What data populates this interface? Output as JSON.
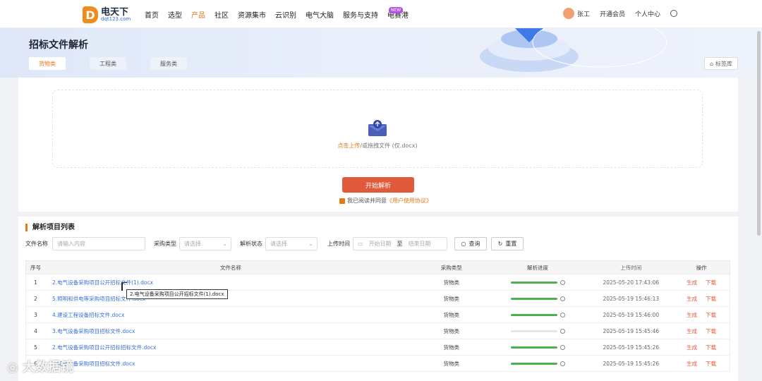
{
  "nav": {
    "logo_mark": "D",
    "logo_cn": "电天下",
    "logo_en": "dqt123.com",
    "items": [
      "首页",
      "选型",
      "产品",
      "社区",
      "资源集市",
      "云识别",
      "电气大脑",
      "服务与支持",
      "电赛港"
    ],
    "active_item": "产品",
    "new_badge": "NEW",
    "user_name": "张工",
    "membership": "开通会员",
    "personal_center": "个人中心"
  },
  "banner": {
    "title": "招标文件解析",
    "tabs": [
      "货物类",
      "工程类",
      "服务类"
    ],
    "selected_tab": "货物类",
    "library_button": "标签库"
  },
  "upload": {
    "link_text": "点击上传",
    "hint_text": "/或拖拽文件 (仅.docx)",
    "start_button": "开始解析",
    "agree_text": "我已阅读并同意",
    "agree_link": "《用户使用协议》"
  },
  "list": {
    "title": "解析项目列表",
    "filters": {
      "name_label": "文件名称",
      "name_placeholder": "请输入内容",
      "category_label": "采购类型",
      "category_value": "请选择",
      "status_label": "解析状态",
      "status_value": "请选择",
      "time_label": "上传时间",
      "start_placeholder": "开始日期",
      "range_sep": "至",
      "end_placeholder": "结束日期",
      "search_button": "查询",
      "reset_button": "重置"
    },
    "columns": [
      "序号",
      "文件名称",
      "采购类型",
      "解析进度",
      "上传时间",
      "操作"
    ],
    "rows": [
      {
        "no": "1",
        "name": "2.电气设备采购项目公开招标文件(1).docx",
        "type": "货物类",
        "progress": 1.0,
        "time": "2025-05-20 17:43:06",
        "gen": "生成",
        "dl": "下载"
      },
      {
        "no": "2",
        "name": "5.照明和供电等采购项目招标文件.docx",
        "type": "货物类",
        "progress": 1.0,
        "time": "2025-05-19 15:46:13",
        "gen": "生成",
        "dl": "下载"
      },
      {
        "no": "3",
        "name": "4.建设工程设备招标文件.docx",
        "type": "货物类",
        "progress": 1.0,
        "time": "2025-05-19 15:46:00",
        "gen": "生成",
        "dl": "下载"
      },
      {
        "no": "4",
        "name": "3.电气设备采购项目招标文件.docx",
        "type": "货物类",
        "progress": 0.0,
        "time": "2025-05-19 15:45:46",
        "gen": "生成",
        "dl": "下载"
      },
      {
        "no": "5",
        "name": "2.电气设备采购项目公开招标招标文件.docx",
        "type": "货物类",
        "progress": 1.0,
        "time": "2025-05-19 15:45:26",
        "gen": "生成",
        "dl": "下载"
      },
      {
        "no": "6",
        "name": "1.配电设备采购项目招标文件.docx",
        "type": "货物类",
        "progress": 1.0,
        "time": "2025-05-19 15:45:26",
        "gen": "生成",
        "dl": "下载"
      }
    ],
    "tooltip": "2.电气设备采购项目公开招标文件(1).docx"
  },
  "watermark": "大数据镜"
}
